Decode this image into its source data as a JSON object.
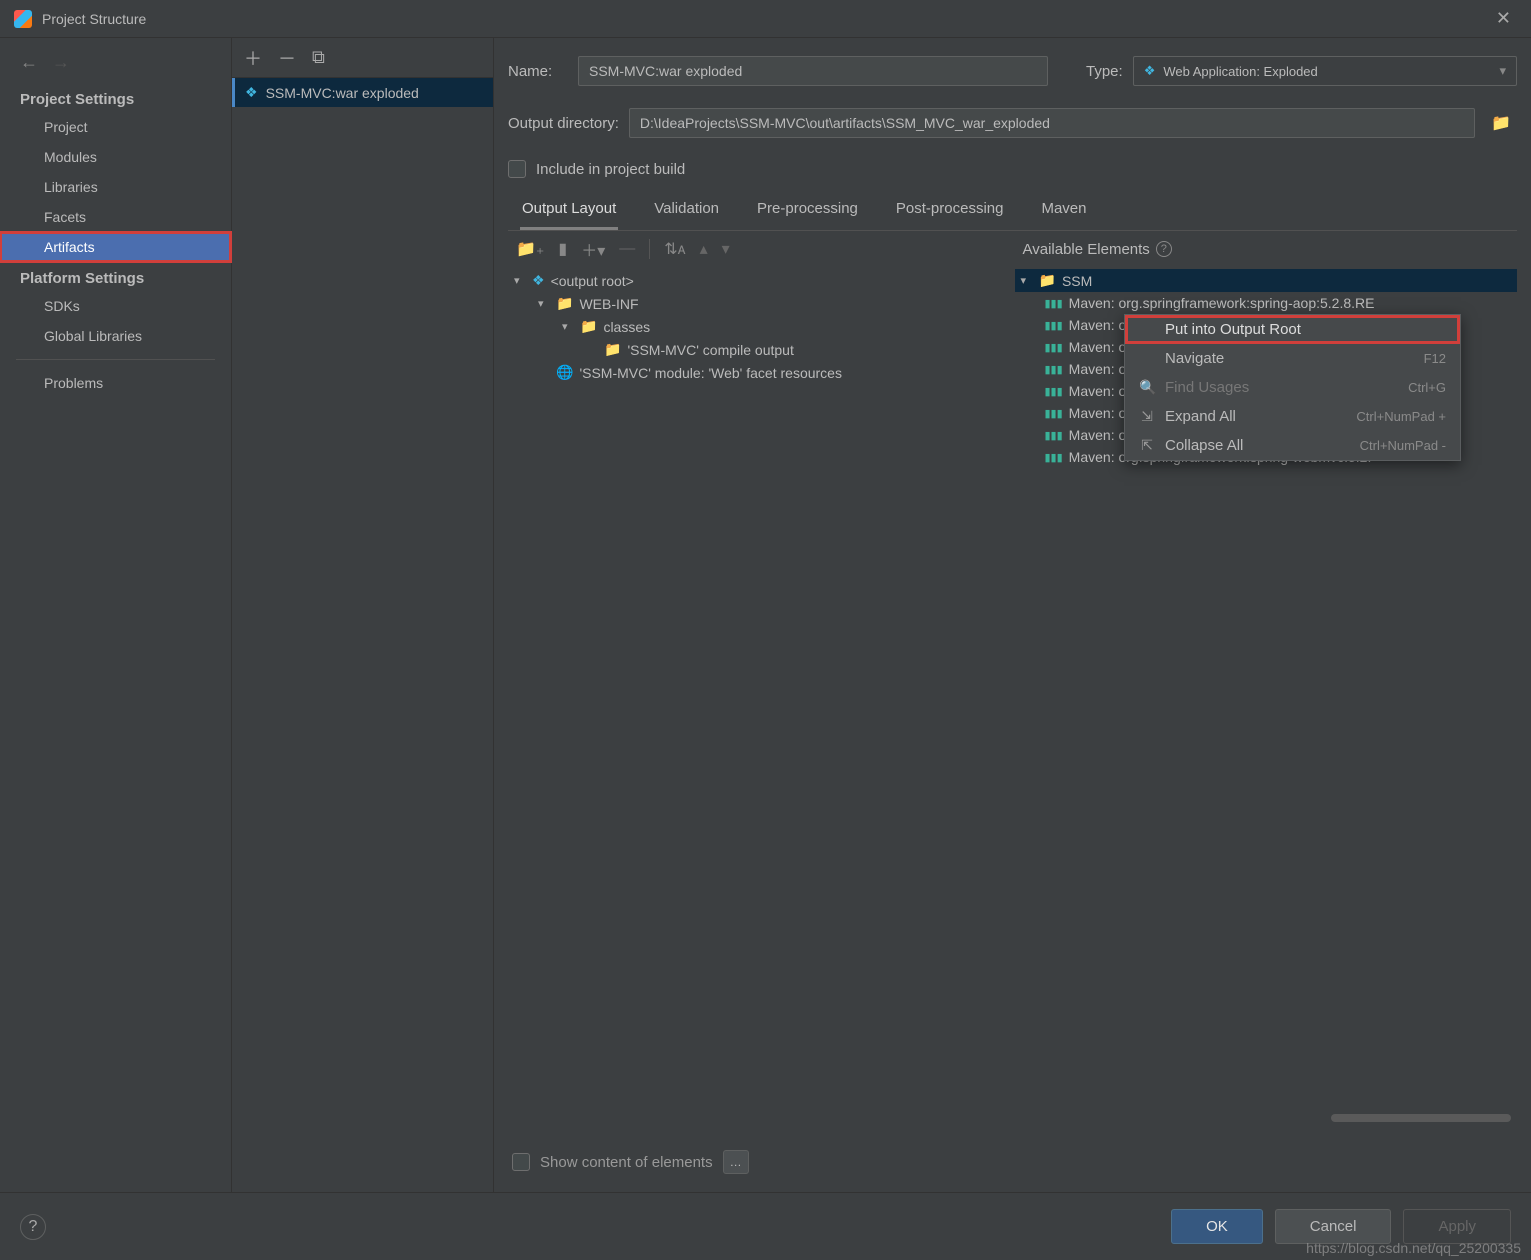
{
  "titlebar": {
    "title": "Project Structure"
  },
  "sidebar": {
    "headings": {
      "project": "Project Settings",
      "platform": "Platform Settings"
    },
    "project_items": [
      "Project",
      "Modules",
      "Libraries",
      "Facets",
      "Artifacts"
    ],
    "platform_items": [
      "SDKs",
      "Global Libraries"
    ],
    "problems": "Problems"
  },
  "artifact_list": {
    "item": "SSM-MVC:war exploded"
  },
  "form": {
    "name_label": "Name:",
    "name_value": "SSM-MVC:war exploded",
    "type_label": "Type:",
    "type_value": "Web Application: Exploded",
    "outdir_label": "Output directory:",
    "outdir_value": "D:\\IdeaProjects\\SSM-MVC\\out\\artifacts\\SSM_MVC_war_exploded",
    "include_label": "Include in project build"
  },
  "tabs": [
    "Output Layout",
    "Validation",
    "Pre-processing",
    "Post-processing",
    "Maven"
  ],
  "layout_tree": [
    {
      "text": "<output root>",
      "indent": 0,
      "icon": "web",
      "chev": "v"
    },
    {
      "text": "WEB-INF",
      "indent": 1,
      "icon": "folder",
      "chev": "v"
    },
    {
      "text": "classes",
      "indent": 2,
      "icon": "folder",
      "chev": "v"
    },
    {
      "text": "'SSM-MVC' compile output",
      "indent": 3,
      "icon": "compile",
      "chev": ""
    },
    {
      "text": "'SSM-MVC' module: 'Web' facet resources",
      "indent": 1,
      "icon": "webres",
      "chev": ""
    }
  ],
  "available": {
    "header": "Available Elements",
    "root": "SSM",
    "items": [
      "Maven: org.springframework:spring-aop:5.2.8.RE",
      "Maven: org.springframework:spring-beans:5.2.8.RE",
      "Maven: org.springframework:spring-context:5.2.8",
      "Maven: org.springframework:spring-core:5.2.8.RE",
      "Maven: org.springframework:spring-expression:5",
      "Maven: org.springframework:spring-jcl:5.2.8.RELE",
      "Maven: org.springframework:spring-web:5.2.8.RE",
      "Maven: org.springframework:spring-webmvc:5.2."
    ]
  },
  "context_menu": [
    {
      "label": "Put into Output Root",
      "shortcut": "",
      "highlight": true,
      "icon": ""
    },
    {
      "label": "Navigate",
      "shortcut": "F12",
      "icon": ""
    },
    {
      "label": "Find Usages",
      "shortcut": "Ctrl+G",
      "disabled": true,
      "icon": "search"
    },
    {
      "label": "Expand All",
      "shortcut": "Ctrl+NumPad +",
      "icon": "expand"
    },
    {
      "label": "Collapse All",
      "shortcut": "Ctrl+NumPad -",
      "icon": "collapse"
    }
  ],
  "show_content_label": "Show content of elements",
  "footer": {
    "ok": "OK",
    "cancel": "Cancel",
    "apply": "Apply"
  },
  "watermark": "https://blog.csdn.net/qq_25200335"
}
